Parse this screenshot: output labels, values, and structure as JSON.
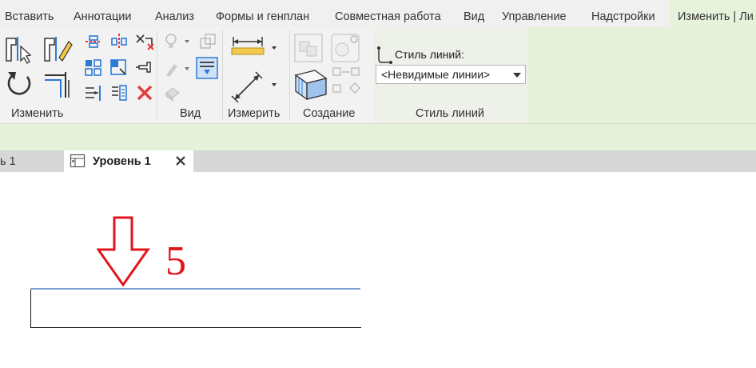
{
  "ribbon_tabs": [
    {
      "label": "Вставить",
      "active": false
    },
    {
      "label": "Аннотации",
      "active": false
    },
    {
      "label": "Анализ",
      "active": false
    },
    {
      "label": "Формы и генплан",
      "active": false
    },
    {
      "label": "Совместная работа",
      "active": false
    },
    {
      "label": "Вид",
      "active": false
    },
    {
      "label": "Управление",
      "active": false
    },
    {
      "label": "Надстройки",
      "active": false
    },
    {
      "label": "Изменить | Ли",
      "active": true
    }
  ],
  "panels": {
    "modify": "Изменить",
    "view": "Вид",
    "measure": "Измерить",
    "create": "Создание",
    "line_style": "Стиль линий"
  },
  "line_style": {
    "label": "Стиль линий:",
    "selected": "<Невидимые линии>"
  },
  "view_tabs": {
    "inactive_label": "нь 1",
    "active_label": "Уровень 1"
  },
  "annotation": {
    "number": "5",
    "color": "#e2141c"
  },
  "colors": {
    "context_tab_bg": "#e5f1d9",
    "selected_line": "#7e9ed6"
  },
  "icons": [
    "modify-select-icon",
    "match-properties-icon",
    "rotate-icon",
    "trim-extend-icon",
    "align-icon",
    "offset-icon",
    "mirror-icon",
    "move-icon",
    "copy-icon",
    "split-icon",
    "pin-icon",
    "unpin-icon",
    "delete-icon",
    "hide-icon",
    "override-graphics-icon",
    "linework-icon",
    "aligned-dimension-icon",
    "measure-icon",
    "create-group-icon",
    "create-similar-icon",
    "create-parts-icon",
    "line-style-icon",
    "view-plan-icon",
    "close-icon",
    "arrow-down-icon"
  ]
}
